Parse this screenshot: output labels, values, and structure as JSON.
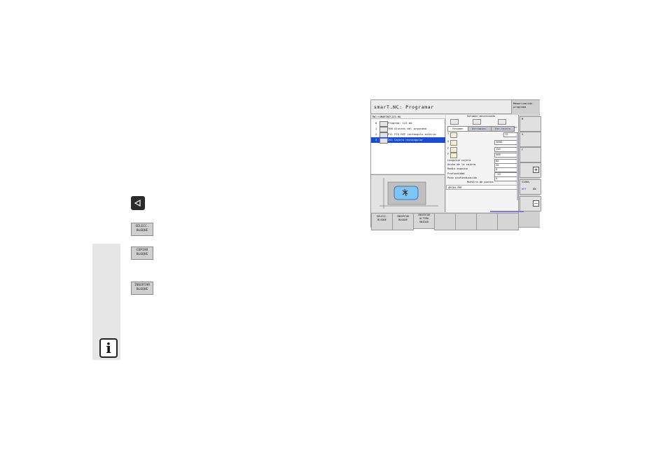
{
  "side_keys": {
    "select": [
      "SELECC.",
      "BLOQUE"
    ],
    "copy": [
      "COPIAR",
      "BLOQUE"
    ],
    "insert": [
      "INSERTAR",
      "BLOQUE"
    ]
  },
  "info_icon_label": "i",
  "screen": {
    "title": "smarT.NC: Programar",
    "mode_label": [
      "Memorización",
      "programa"
    ],
    "path": "TNC:\\SMARTNC\\123.HU",
    "tree": [
      {
        "num": "0",
        "label": "Program: 123 mm"
      },
      {
        "num": "1",
        "label": "700 Ajustes del programa"
      },
      {
        "num": "2",
        "label": "Pll PTO REF rectangulo exterio"
      },
      {
        "num": "3",
        "label": "251 Cajera rectangular"
      }
    ],
    "form": {
      "heading": "Volumen mecanizado",
      "tabs": [
        "Resumen",
        "Herramien.",
        "Par.cajera"
      ],
      "tab_more": ">>",
      "tool_fields": [
        {
          "label": "T",
          "value": "12"
        },
        {
          "label": "S",
          "value": "3000"
        },
        {
          "label": "F",
          "value": "150"
        },
        {
          "label": "F",
          "value": "500"
        }
      ],
      "params": [
        {
          "label": "Longitud cajera",
          "value": "60"
        },
        {
          "label": "Ancho de la cajera",
          "value": "20"
        },
        {
          "label": "Radio esquina",
          "value": "0"
        },
        {
          "label": "Profundidad",
          "value": "-20"
        },
        {
          "label": "Paso profundización",
          "value": "5"
        }
      ],
      "pattern_heading": "Muestra de puntos",
      "pattern_value": "ARC04.PNT"
    },
    "right_keys": [
      "M",
      "S",
      "F",
      "S100%",
      "OFF",
      "ON"
    ],
    "softkeys": [
      [
        "SELECC.",
        "BLOQUE"
      ],
      [
        "INSERTAR",
        "BLOQUE"
      ],
      [
        "INSERTAR",
        "ULTIMA",
        "UNIDAD"
      ],
      [],
      [],
      [],
      [],
      []
    ]
  }
}
